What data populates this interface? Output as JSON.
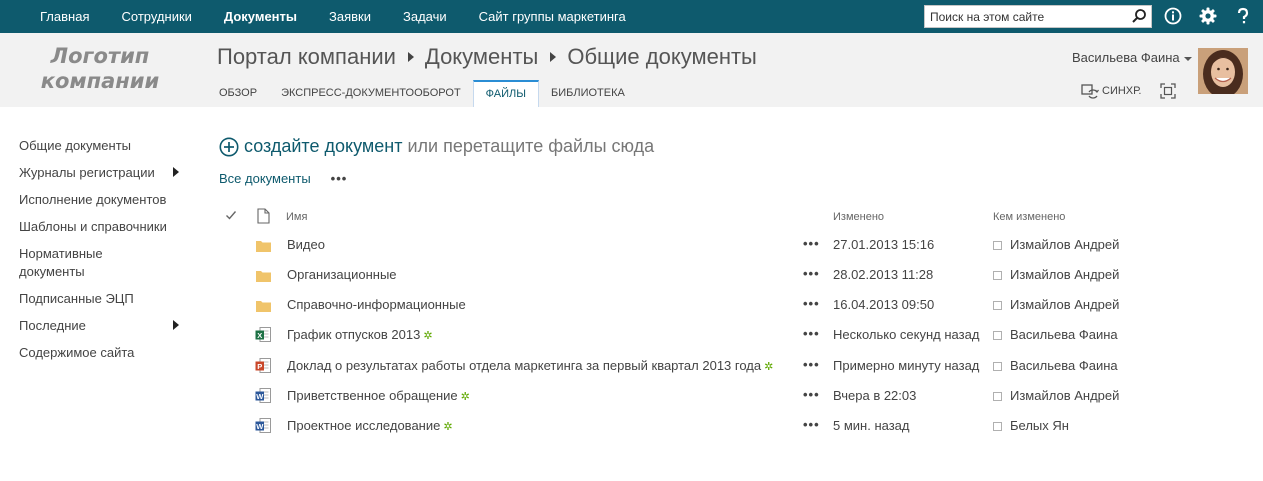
{
  "topnav": {
    "items": [
      "Главная",
      "Сотрудники",
      "Документы",
      "Заявки",
      "Задачи",
      "Сайт группы маркетинга"
    ],
    "active_index": 2
  },
  "search": {
    "placeholder": "Поиск на этом сайте"
  },
  "icons": {
    "info": "info-icon",
    "settings": "gear-icon",
    "help": "help-icon"
  },
  "logo": {
    "line1": "Логотип",
    "line2": "компании"
  },
  "breadcrumb": [
    "Портал компании",
    "Документы",
    "Общие документы"
  ],
  "tabs": [
    "ОБЗОР",
    "ЭКСПРЕСС-ДОКУМЕНТООБОРОТ",
    "ФАЙЛЫ",
    "БИБЛИОТЕКА"
  ],
  "selected_tab": 2,
  "user": {
    "name": "Васильева Фаина"
  },
  "actions": {
    "sync": "СИНХР."
  },
  "leftnav": [
    {
      "label": "Общие документы",
      "has_children": false
    },
    {
      "label": "Журналы регистрации",
      "has_children": true
    },
    {
      "label": "Исполнение документов",
      "has_children": false
    },
    {
      "label": "Шаблоны и справочники",
      "has_children": false
    },
    {
      "label": "Нормативные документы",
      "has_children": false
    },
    {
      "label": "Подписанные ЭЦП",
      "has_children": false
    },
    {
      "label": "Последние",
      "has_children": true
    },
    {
      "label": "Содержимое сайта",
      "has_children": false
    }
  ],
  "newdoc": {
    "create": "создайте документ",
    "or": "или перетащите файлы сюда"
  },
  "views": {
    "all": "Все документы",
    "more": "•••"
  },
  "columns": {
    "name": "Имя",
    "modified": "Изменено",
    "modified_by": "Кем изменено"
  },
  "rows": [
    {
      "type": "folder",
      "name": "Видео",
      "modified": "27.01.2013 15:16",
      "by": "Измайлов Андрей",
      "new": false
    },
    {
      "type": "folder",
      "name": "Организационные",
      "modified": "28.02.2013 11:28",
      "by": "Измайлов Андрей",
      "new": false
    },
    {
      "type": "folder",
      "name": "Справочно-информационные",
      "modified": "16.04.2013 09:50",
      "by": "Измайлов Андрей",
      "new": false
    },
    {
      "type": "excel",
      "name": "График отпусков 2013",
      "modified": "Несколько секунд назад",
      "by": "Васильева Фаина",
      "new": true
    },
    {
      "type": "powerpoint",
      "name": "Доклад о результатах работы отдела маркетинга за первый квартал 2013 года",
      "modified": "Примерно минуту назад",
      "by": "Васильева Фаина",
      "new": true
    },
    {
      "type": "word",
      "name": "Приветственное обращение",
      "modified": "Вчера в 22:03",
      "by": "Измайлов Андрей",
      "new": true
    },
    {
      "type": "word",
      "name": "Проектное исследование",
      "modified": "5 мин. назад",
      "by": "Белых Ян",
      "new": true
    }
  ],
  "colors": {
    "brand": "#0e5a6d",
    "folder": "#f0c46a",
    "excel": "#1e7145",
    "powerpoint": "#c9472a",
    "word": "#2b579a",
    "new_marker": "#5fa800"
  }
}
